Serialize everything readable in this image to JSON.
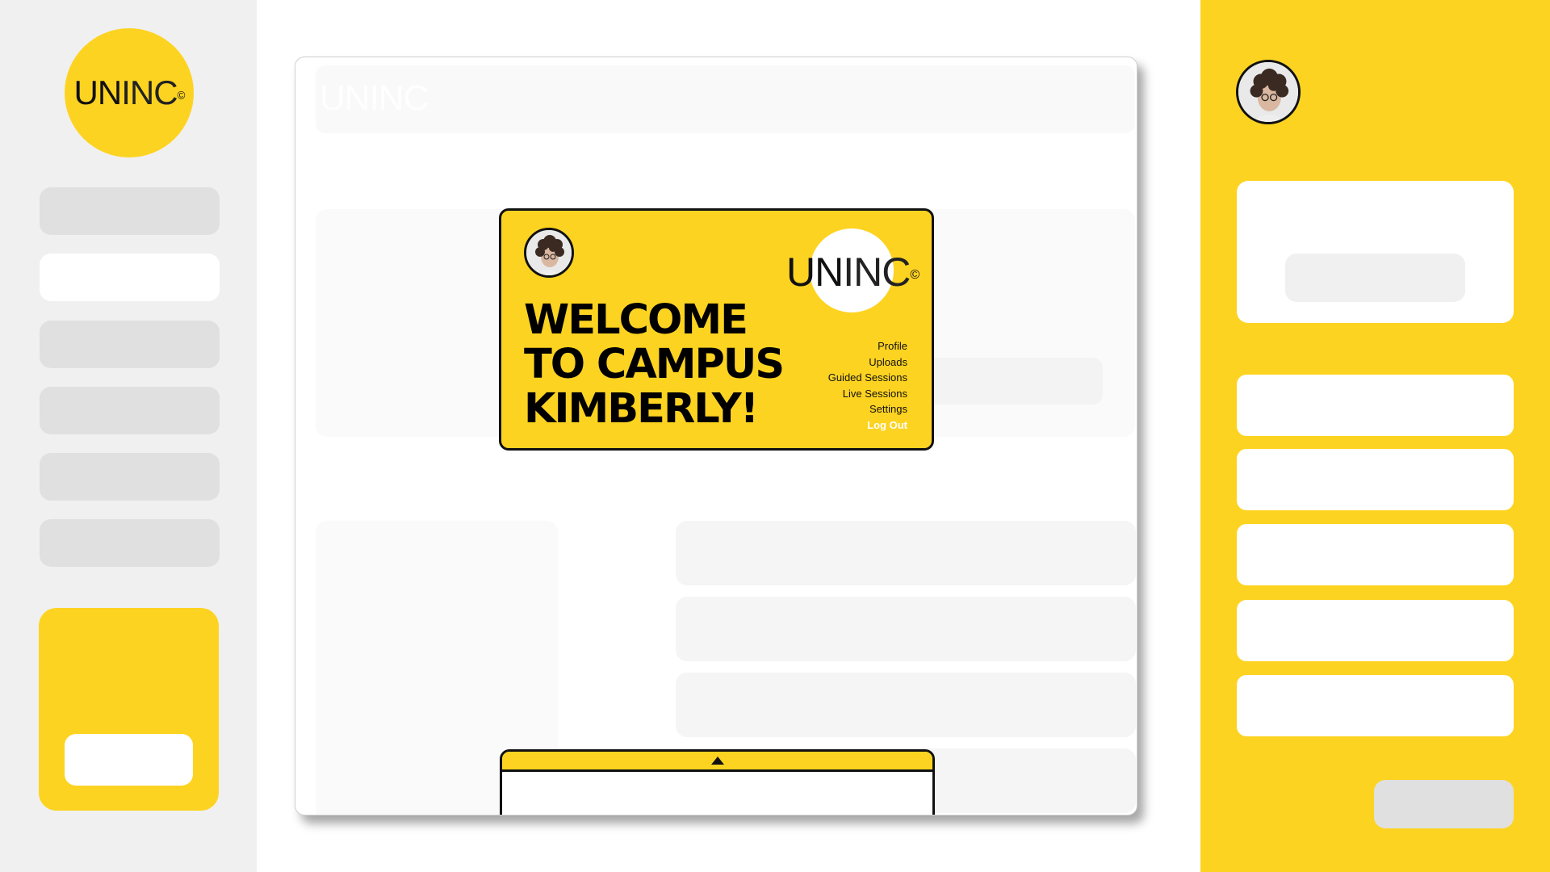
{
  "brand": {
    "logo_bold": "UN",
    "logo_thin": "INC",
    "copyright": "©",
    "accent": "#FDD321",
    "panel_bg": "#F0F0F0",
    "placeholder": "#E0E0E0"
  },
  "welcome_card": {
    "heading_line1": "WELCOME",
    "heading_line2": "TO CAMPUS",
    "heading_line3": "KIMBERLY!",
    "menu": [
      "Profile",
      "Uploads",
      "Guided Sessions",
      "Live Sessions",
      "Settings",
      "Log Out"
    ]
  },
  "bottom_drawer": {
    "toggle_icon": "caret-up-icon"
  }
}
